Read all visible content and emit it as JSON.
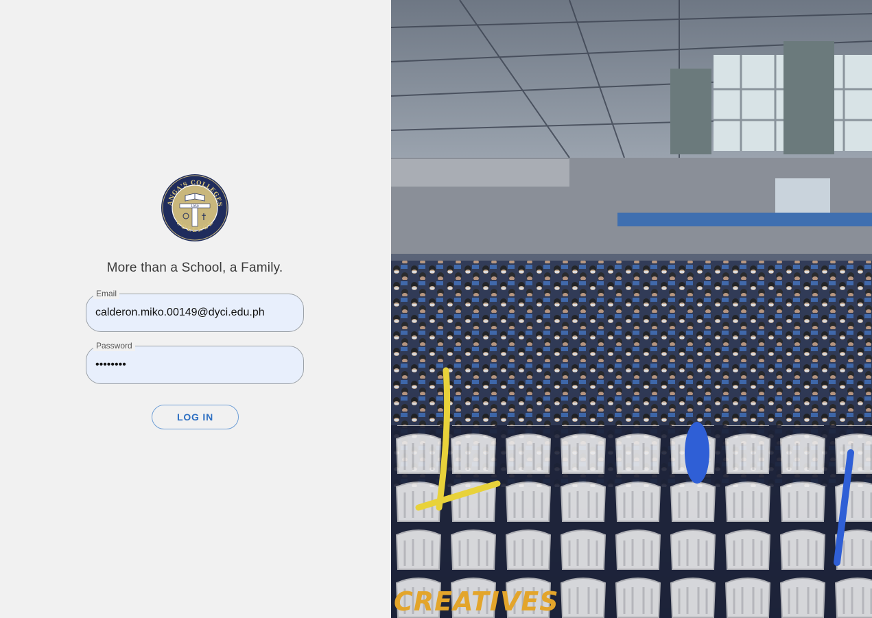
{
  "logo": {
    "top_text": "DR. YANGA'S COLLEGES INC.",
    "bottom_text": "COLLEGE",
    "year": "1950",
    "colors": {
      "ring": "#1f2c5c",
      "field": "#c9b77c",
      "gold": "#d6c27a"
    }
  },
  "tagline": "More than a School, a Family.",
  "form": {
    "email": {
      "label": "Email",
      "value": "calderon.miko.00149@dyci.edu.ph"
    },
    "password": {
      "label": "Password",
      "value": "••••••••"
    },
    "login_label": "LOG IN"
  },
  "photo": {
    "credit": "CREATIVES"
  },
  "colors": {
    "accent": "#2d6fc2",
    "input_bg": "#e8effc",
    "left_bg": "#f1f1f1"
  }
}
